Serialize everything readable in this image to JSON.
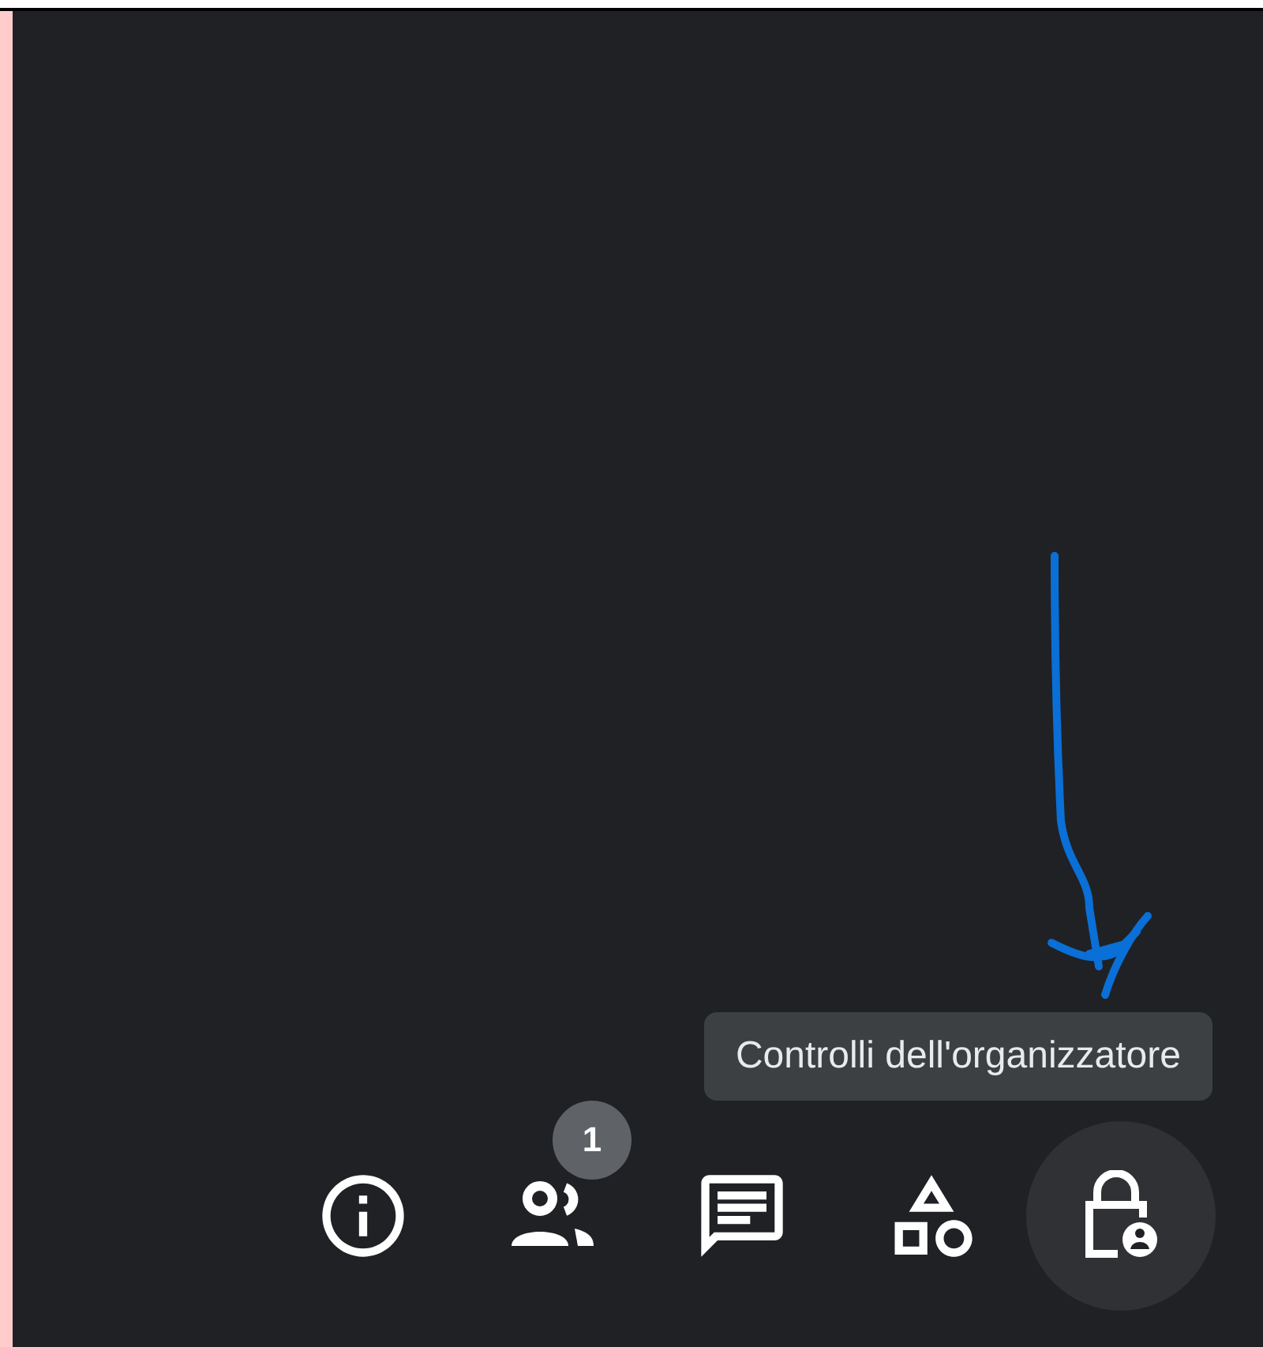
{
  "tooltip": {
    "text": "Controlli dell'organizzatore"
  },
  "toolbar": [
    {
      "kind": "info",
      "highlighted": false
    },
    {
      "kind": "people",
      "highlighted": false,
      "badge": "1"
    },
    {
      "kind": "chat",
      "highlighted": false
    },
    {
      "kind": "activities",
      "highlighted": false
    },
    {
      "kind": "host-controls",
      "highlighted": true
    }
  ],
  "annotation": {
    "kind": "arrow"
  }
}
